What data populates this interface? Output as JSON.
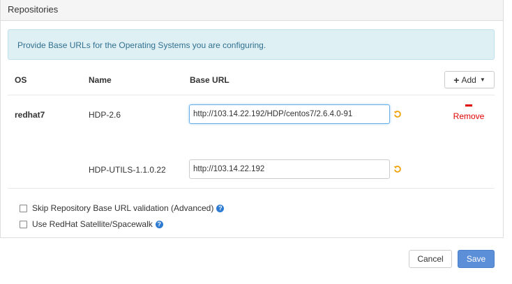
{
  "panel": {
    "title": "Repositories"
  },
  "info": {
    "text": "Provide Base URLs for the Operating Systems you are configuring."
  },
  "table": {
    "headers": {
      "os": "OS",
      "name": "Name",
      "base_url": "Base URL"
    },
    "add_button": {
      "label": "Add",
      "icon": "plus-icon",
      "dropdown_icon": "caret-down-icon"
    },
    "os_group": {
      "os": "redhat7",
      "remove_label": "Remove",
      "repos": [
        {
          "name": "HDP-2.6",
          "base_url": "http://103.14.22.192/HDP/centos7/2.6.4.0-91",
          "focused": true,
          "reset_icon": "undo-icon"
        },
        {
          "name": "HDP-UTILS-1.1.0.22",
          "base_url": "http://103.14.22.192",
          "focused": false,
          "reset_icon": "undo-icon"
        }
      ]
    }
  },
  "options": [
    {
      "label": "Skip Repository Base URL validation (Advanced)",
      "checked": false,
      "help_icon": "question-icon"
    },
    {
      "label": "Use RedHat Satellite/Spacewalk",
      "checked": false,
      "help_icon": "question-icon"
    }
  ],
  "footer": {
    "cancel_label": "Cancel",
    "save_label": "Save"
  },
  "colors": {
    "info_bg": "#dff0f4",
    "info_text": "#31708f",
    "remove": "#e00000",
    "undo_icon": "#f0a30a",
    "help_icon": "#2d7bd2",
    "save_bg": "#5b8fd8"
  }
}
